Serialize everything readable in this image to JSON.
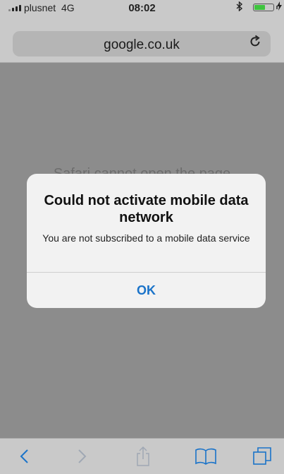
{
  "status_bar": {
    "carrier": "plusnet",
    "network": "4G",
    "time": "08:02",
    "battery_level": 0.55,
    "battery_color": "#3ec43e"
  },
  "address_bar": {
    "url": "google.co.uk",
    "reload_icon": "reload-icon"
  },
  "page": {
    "background_text": "Safari cannot open the page"
  },
  "alert": {
    "title": "Could not activate mobile data network",
    "message": "You are not subscribed to a mobile data service",
    "ok_label": "OK",
    "ok_color": "#1a73c9"
  },
  "toolbar": {
    "icons": [
      "back-icon",
      "forward-icon",
      "share-icon",
      "bookmarks-icon",
      "tabs-icon"
    ],
    "accent": "#1a73c9",
    "disabled": "#a0a8b4"
  }
}
